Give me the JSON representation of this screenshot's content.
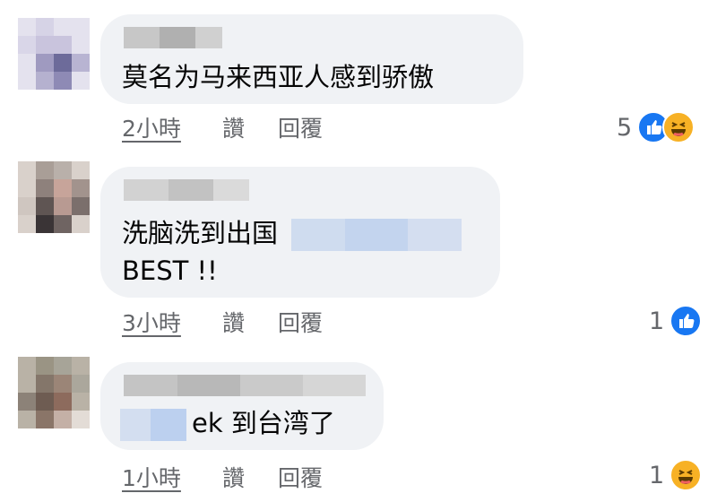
{
  "comments": [
    {
      "text_lines": [
        "莫名为马来西亚人感到骄傲"
      ],
      "time": "2小時",
      "like_label": "讚",
      "reply_label": "回覆",
      "reaction_count": "5",
      "reactions": [
        "like-icon",
        "haha-icon"
      ]
    },
    {
      "text_lines": [
        "洗脑洗到出国",
        "BEST !!"
      ],
      "time": "3小時",
      "like_label": "讚",
      "reply_label": "回覆",
      "reaction_count": "1",
      "reactions": [
        "like-icon"
      ]
    },
    {
      "text_lines": [
        "ek 到台湾了"
      ],
      "time": "1小時",
      "like_label": "讚",
      "reply_label": "回覆",
      "reaction_count": "1",
      "reactions": [
        "haha-icon"
      ]
    }
  ],
  "colors": {
    "bubble": "#f0f2f5",
    "secondary_text": "#65676b",
    "like_blue": "#1877f2",
    "haha_yellow": "#f7b125"
  }
}
